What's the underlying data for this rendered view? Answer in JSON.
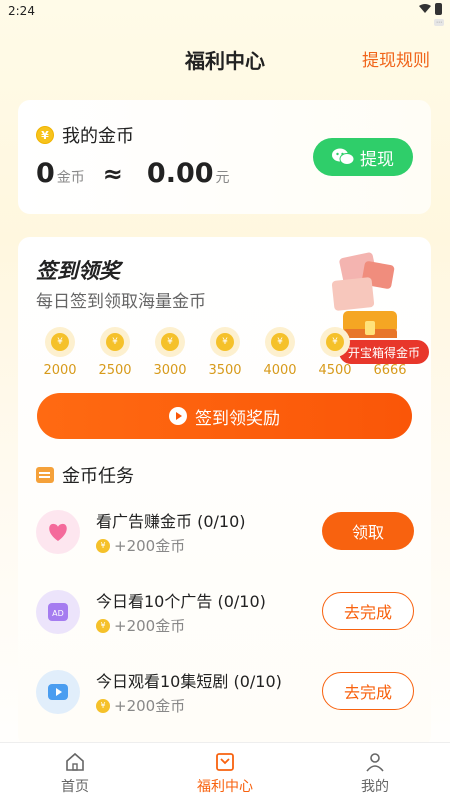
{
  "status": {
    "time": "2:24"
  },
  "header": {
    "title": "福利中心",
    "rules": "提现规则"
  },
  "coins": {
    "label": "我的金币",
    "amount": "0",
    "amount_unit": "金币",
    "approx": "≈",
    "cash": "0.00",
    "cash_unit": "元",
    "withdraw": "提现"
  },
  "signin": {
    "title": "签到领奖",
    "subtitle": "每日签到领取海量金币",
    "chest_badge": "开宝箱得金币",
    "days": [
      "2000",
      "2500",
      "3000",
      "3500",
      "4000",
      "4500",
      "6666"
    ],
    "button": "签到领奖励"
  },
  "tasks": {
    "title": "金币任务",
    "items": [
      {
        "name": "看广告赚金币 (0/10)",
        "reward": "+200金币",
        "button": "领取",
        "style": "filled",
        "icon": "heart-video-icon"
      },
      {
        "name": "今日看10个广告 (0/10)",
        "reward": "+200金币",
        "button": "去完成",
        "style": "outline",
        "icon": "ad-icon"
      },
      {
        "name": "今日观看10集短剧 (0/10)",
        "reward": "+200金币",
        "button": "去完成",
        "style": "outline",
        "icon": "drama-play-icon"
      }
    ]
  },
  "tabbar": {
    "items": [
      {
        "label": "首页",
        "icon": "home-icon"
      },
      {
        "label": "福利中心",
        "icon": "welfare-icon",
        "active": true
      },
      {
        "label": "我的",
        "icon": "user-icon"
      }
    ]
  },
  "colors": {
    "accent": "#f8620f",
    "wechat": "#2fce6a",
    "coin": "#f5c12a"
  }
}
